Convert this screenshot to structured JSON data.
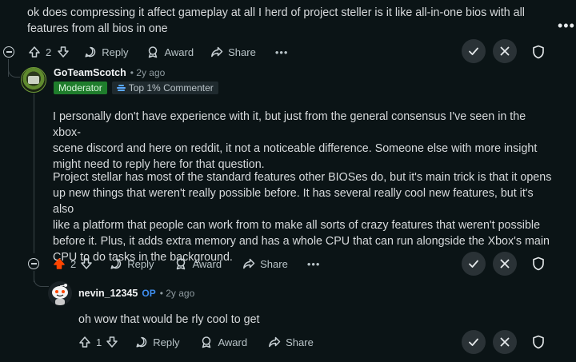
{
  "comment1": {
    "text_line1": "ok does compressing it affect gameplay at all I herd of project steller is it like all-in-one bios with all",
    "text_line2": "features from all bios in one",
    "votes": "2",
    "reply": "Reply",
    "award": "Award",
    "share": "Share"
  },
  "comment2": {
    "username": "GoTeamScotch",
    "time": "• 2y ago",
    "badge_moderator": "Moderator",
    "badge_top": "Top 1% Commenter",
    "para1": [
      "I personally don't have experience with it, but just from the general consensus I've seen in the xbox-",
      "scene discord and here on reddit, it not a noticeable difference. Someone else with more insight",
      "might need to reply here for that question."
    ],
    "para2": [
      "Project stellar has most of the standard features other BIOSes do, but it's main trick is that it opens",
      "up new things that weren't really possible before. It has several really cool new features, but it's also",
      "like a platform that people can work from to make all sorts of crazy features that weren't possible",
      "before it. Plus, it adds extra memory and has a whole CPU that can run alongside the Xbox's main",
      "CPU to do tasks in the background."
    ],
    "votes": "2",
    "reply": "Reply",
    "award": "Award",
    "share": "Share"
  },
  "comment3": {
    "username": "nevin_12345",
    "op": "OP",
    "time": "• 2y ago",
    "text": "oh wow that would be rly cool to get",
    "votes": "1",
    "reply": "Reply",
    "award": "Award",
    "share": "Share"
  },
  "colors": {
    "upvoted": "#ff4500",
    "moderator": "#1f7d2c",
    "op": "#3f8eef"
  }
}
